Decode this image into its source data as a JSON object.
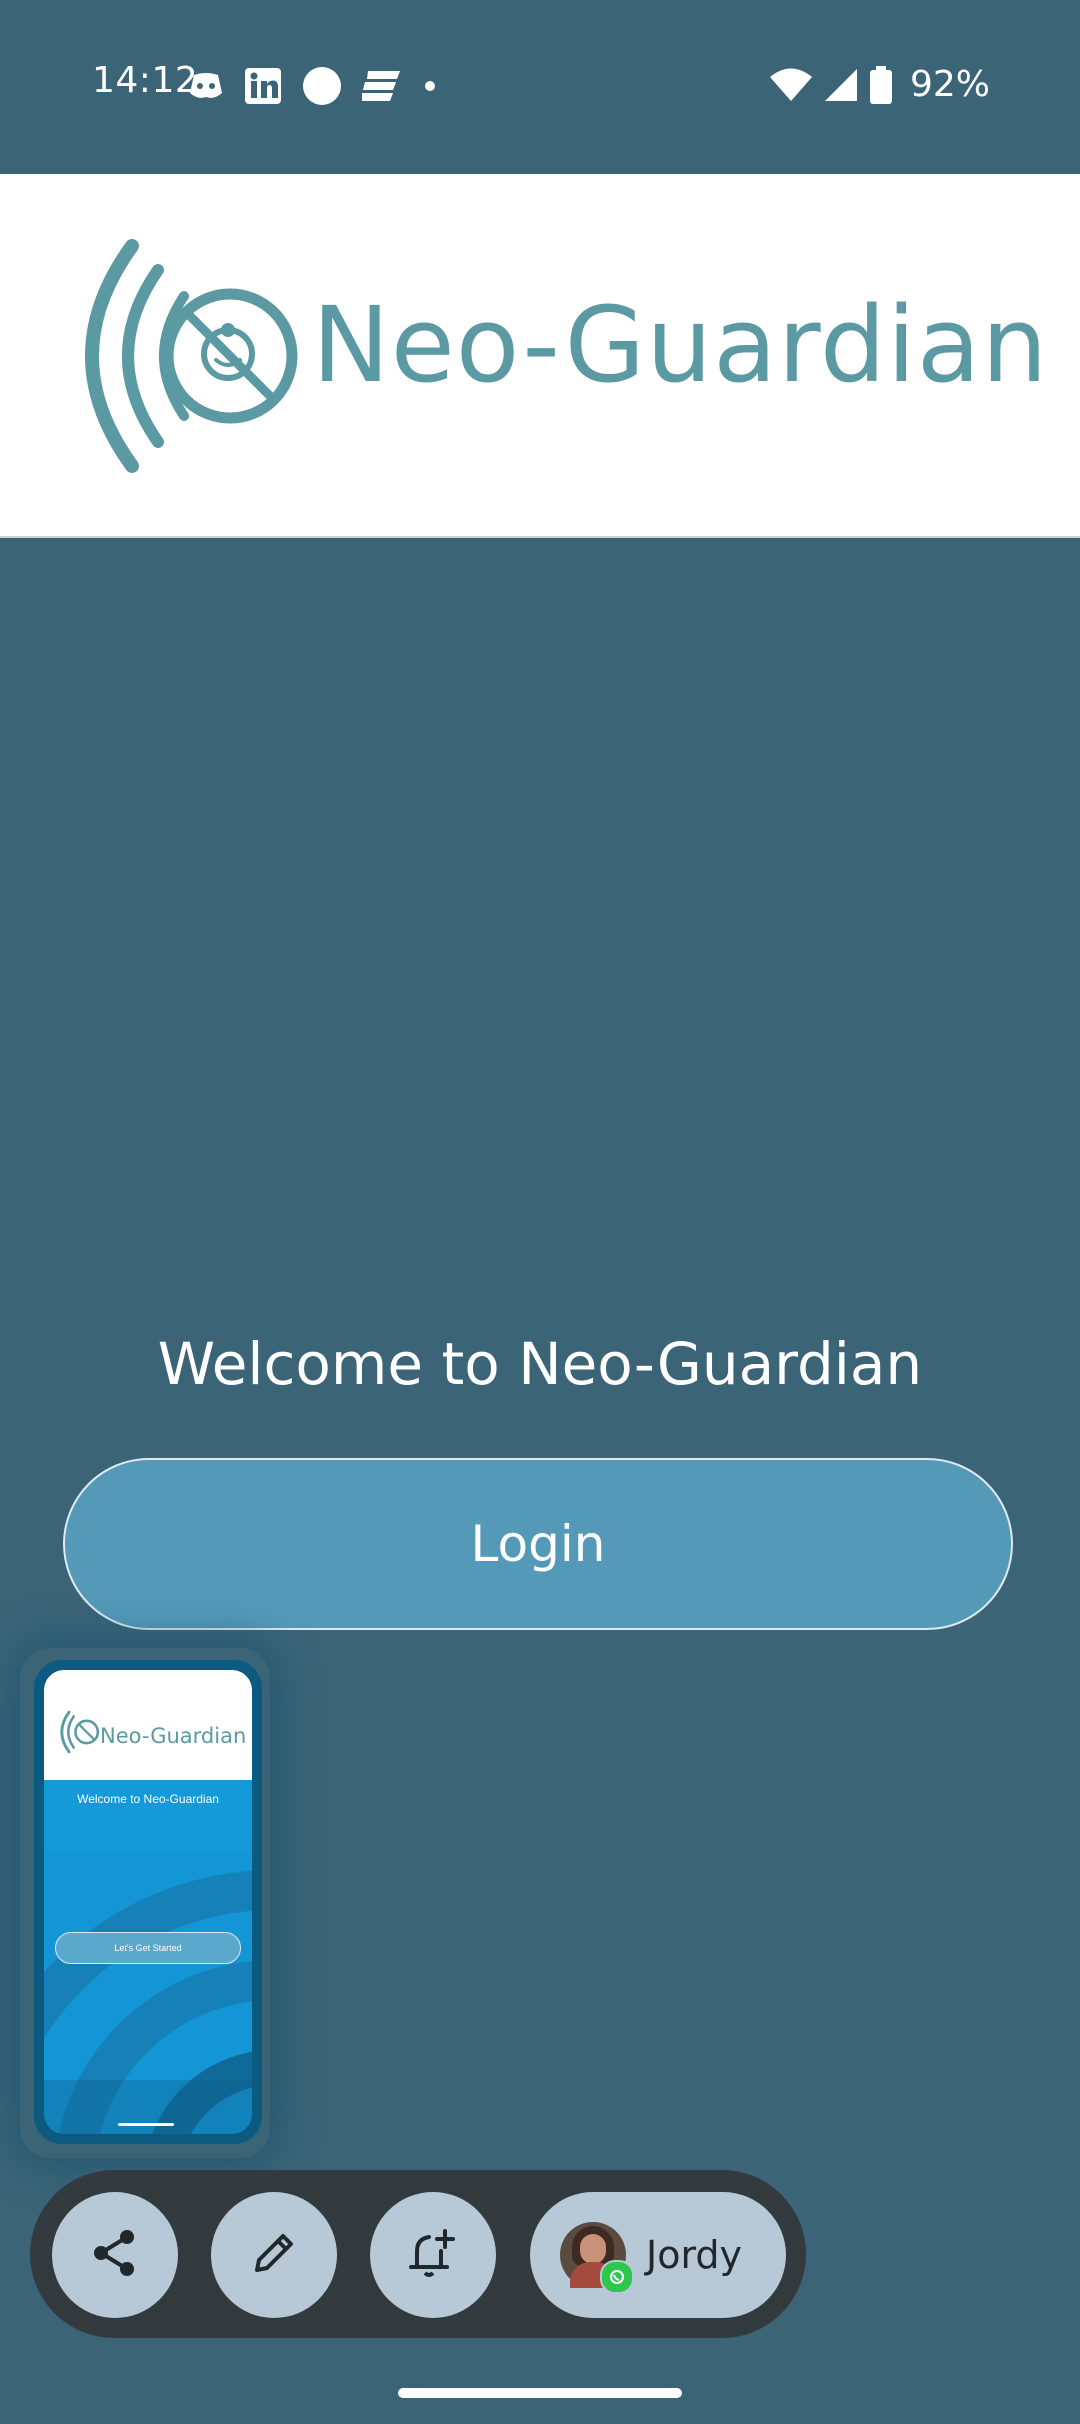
{
  "status_bar": {
    "time": "14:12",
    "notification_icons": [
      "discord-icon",
      "linkedin-icon",
      "circle-app-icon",
      "e-app-icon",
      "dot-icon"
    ],
    "battery": "92%"
  },
  "header": {
    "logo_text": "Neo-Guardian",
    "logo_color": "#5b9aa3"
  },
  "main": {
    "welcome_text": "Welcome to Neo-Guardian",
    "login_label": "Login",
    "background_color": "#3b6477",
    "login_color": "#5599b9"
  },
  "screenshot_preview": {
    "logo_text": "Neo-Guardian",
    "welcome_text": "Welcome to Neo-Guardian",
    "button_label": "Let's Get Started"
  },
  "action_bar": {
    "share_icon": "share-icon",
    "edit_icon": "edit-icon",
    "reminder_icon": "bell-plus-icon",
    "contact_name": "Jordy"
  }
}
